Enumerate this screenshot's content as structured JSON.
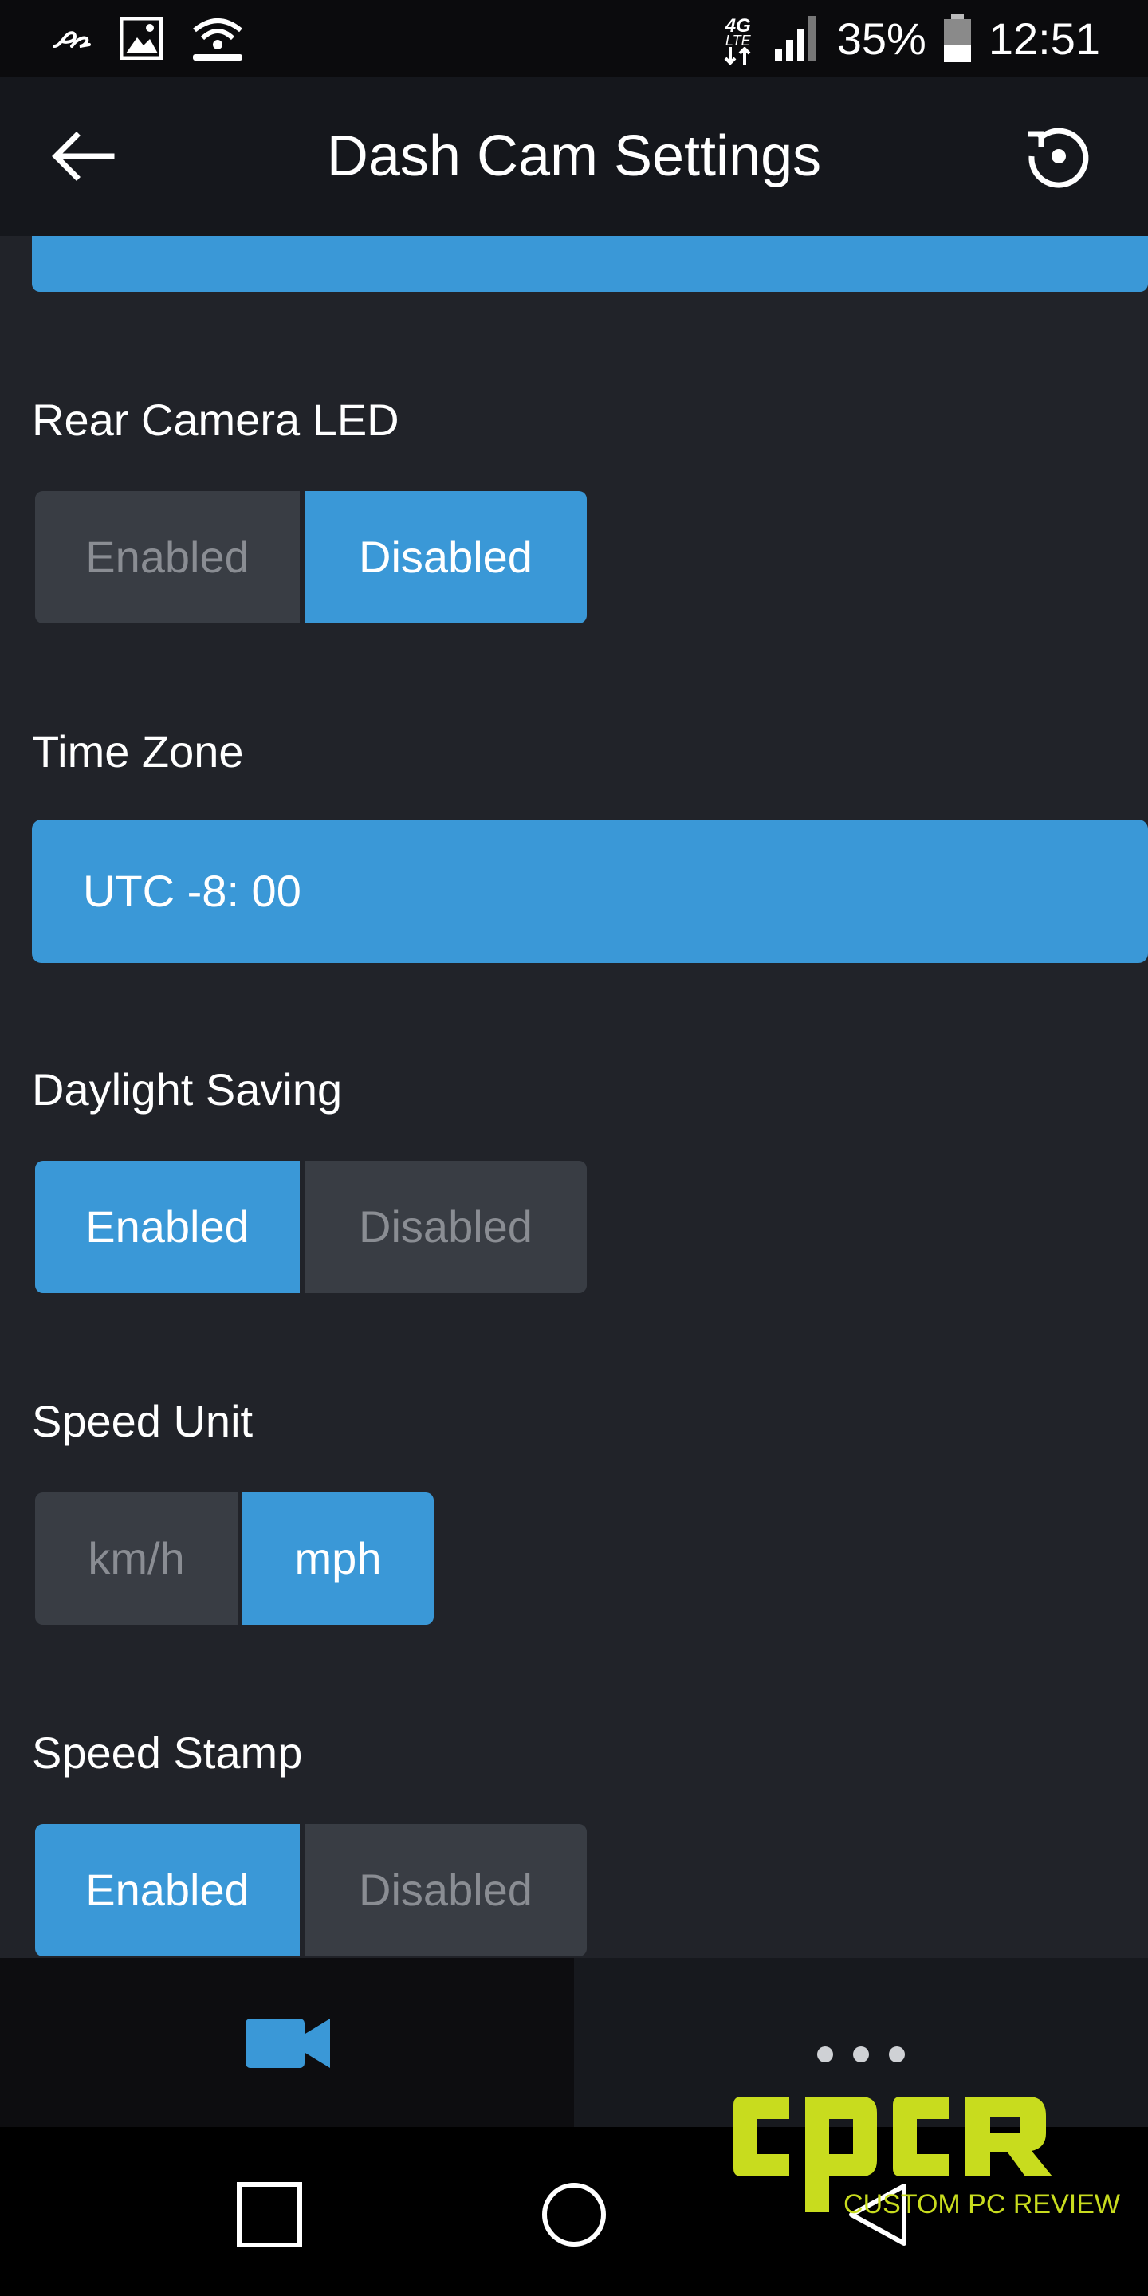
{
  "status_bar": {
    "network": "4G",
    "network_sub": "LTE",
    "battery": "35%",
    "time": "12:51",
    "icons": [
      "assistant-icon",
      "gallery-icon",
      "wifi-hotspot-icon",
      "signal-icon",
      "battery-icon"
    ]
  },
  "app_bar": {
    "title": "Dash Cam Settings",
    "back_icon": "arrow-left-icon",
    "reset_icon": "reset-icon"
  },
  "settings": [
    {
      "label": "Rear Camera LED",
      "options": [
        "Enabled",
        "Disabled"
      ],
      "selected": "Disabled"
    },
    {
      "label": "Time Zone",
      "value": "UTC -8: 00"
    },
    {
      "label": "Daylight Saving",
      "options": [
        "Enabled",
        "Disabled"
      ],
      "selected": "Enabled"
    },
    {
      "label": "Speed Unit",
      "options": [
        "km/h",
        "mph"
      ],
      "selected": "mph"
    },
    {
      "label": "Speed Stamp",
      "options": [
        "Enabled",
        "Disabled"
      ],
      "selected": "Enabled"
    }
  ],
  "tabs": [
    {
      "name": "video-camera-icon",
      "active": true
    },
    {
      "name": "more-dots-icon",
      "active": false
    }
  ],
  "nav": [
    "recents-square-icon",
    "home-circle-icon",
    "back-triangle-icon"
  ],
  "watermark": {
    "logo": "cpcr",
    "tagline": "CUSTOM PC REVIEW"
  },
  "colors": {
    "accent": "#3a98d7",
    "background": "#212329",
    "inactive_option": "#393d44",
    "watermark": "#c8dc1e"
  }
}
